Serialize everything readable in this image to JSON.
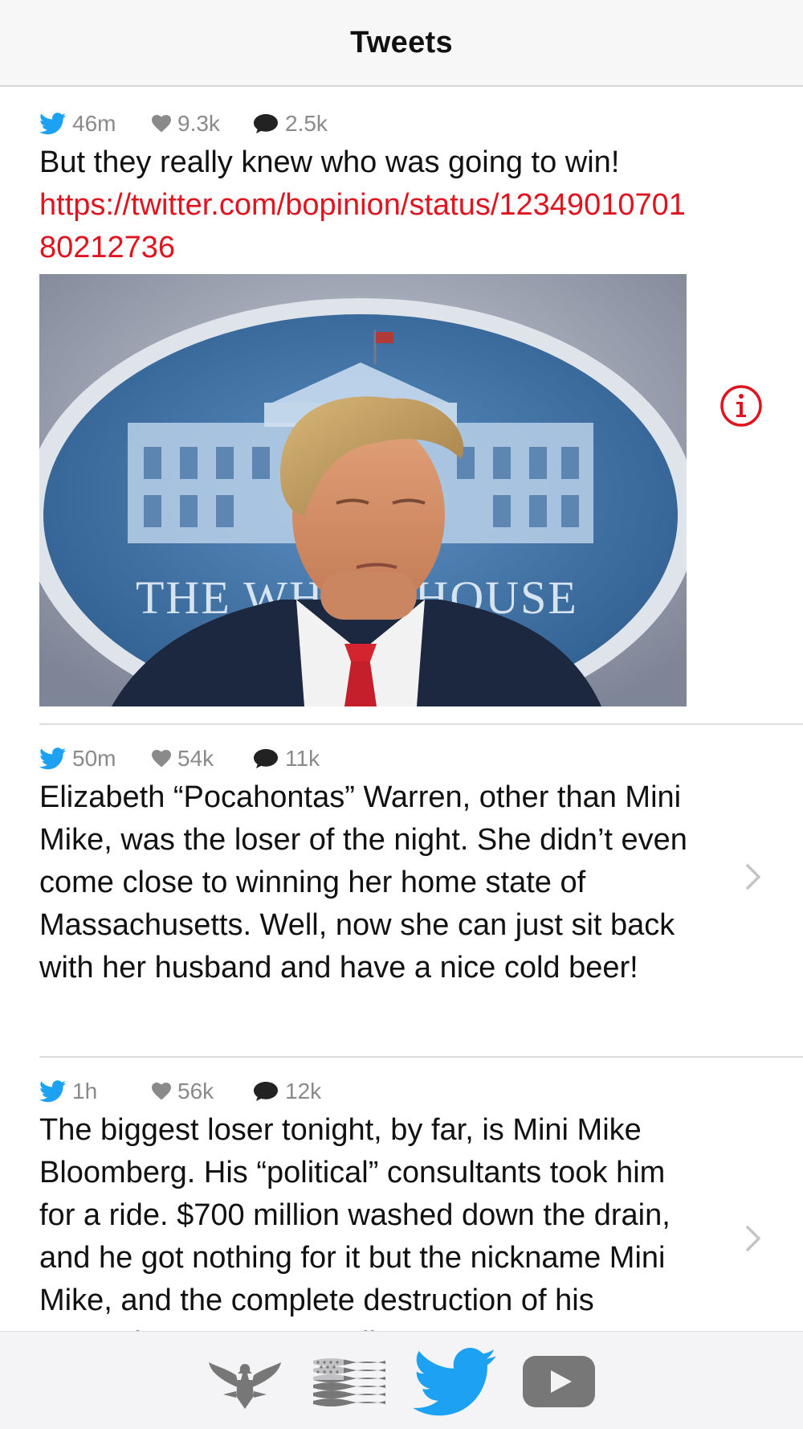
{
  "header": {
    "title": "Tweets"
  },
  "tweets": [
    {
      "time": "46m",
      "likes": "9.3k",
      "comments": "2.5k",
      "text": "But they really knew who was going to win!",
      "link": "https://twitter.com/bopinion/status/1234901070180212736",
      "has_image": true,
      "image_sign_text": "THE WHITE HOUSE",
      "accessory": "info-icon"
    },
    {
      "time": "50m",
      "likes": "54k",
      "comments": "11k",
      "text": "Elizabeth “Pocahontas” Warren, other than Mini Mike, was the loser of the night. She didn’t even come close to winning her home state of Massachusetts. Well, now she can just sit back with her husband and have a nice cold beer!",
      "accessory": "chevron-right-icon"
    },
    {
      "time": "1h",
      "likes": "56k",
      "comments": "12k",
      "text": "The biggest loser tonight, by far, is Mini Mike Bloomberg. His “political” consultants took him for a ride. $700 million washed down the drain, and he got nothing for it but the nickname Mini Mike, and the complete destruction of his reputation. Way to go Mike!",
      "accessory": "chevron-right-icon"
    }
  ],
  "tabbar": {
    "items": [
      "eagle-icon",
      "flag-icon",
      "twitter-bird-icon",
      "youtube-play-icon"
    ],
    "selected": "twitter-bird-icon"
  },
  "colors": {
    "accent_red": "#e0141e",
    "twitter_blue": "#1da1f2",
    "meta_gray": "#8a8a8a",
    "tab_gray": "#777777"
  }
}
